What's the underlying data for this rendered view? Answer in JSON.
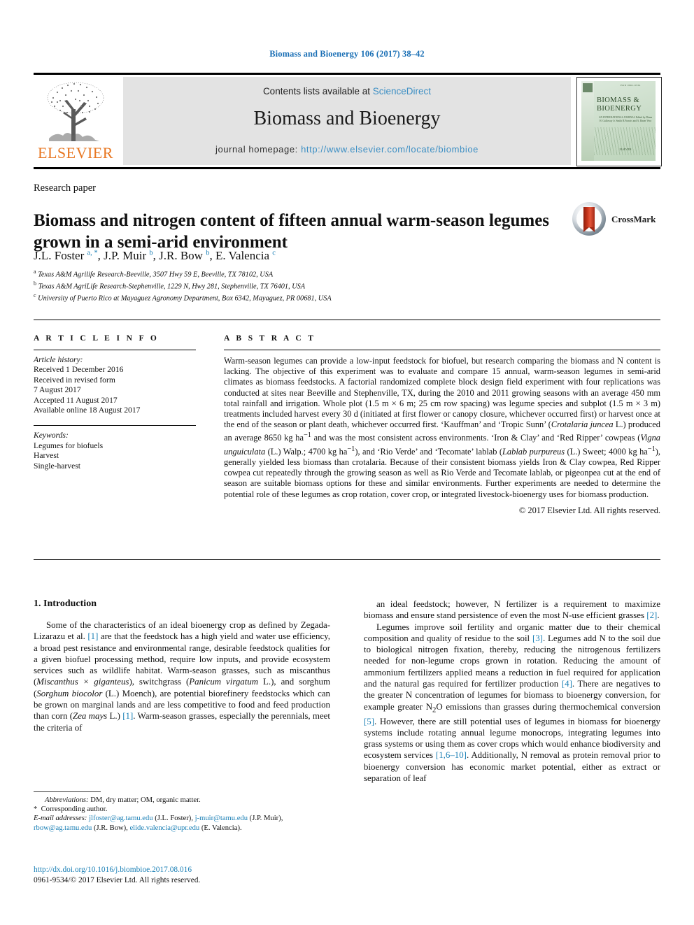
{
  "running_head": "Biomass and Bioenergy 106 (2017) 38–42",
  "journal_header": {
    "publisher_name": "ELSEVIER",
    "contents_prefix": "Contents lists available at ",
    "contents_link": "ScienceDirect",
    "journal_title": "Biomass and Bioenergy",
    "homepage_label": "journal homepage: ",
    "homepage_url": "http://www.elsevier.com/locate/biombioe",
    "cover": {
      "issn_top": "ISSN 0961-9534",
      "title_line1": "BIOMASS &",
      "title_line2": "BIOENERGY",
      "subtitle": "AN INTERNATIONAL JOURNAL\nEdited by Diana H. Galloway Jr. Smith\nR.Francis and A. Bauer Vera",
      "bottom": "ELSEVIER"
    }
  },
  "article": {
    "type": "Research paper",
    "title": "Biomass and nitrogen content of fifteen annual warm-season legumes grown in a semi-arid environment",
    "crossmark_label": "CrossMark",
    "authors_html": "J.L. Foster <sup>a, *</sup>, J.P. Muir <sup>b</sup>, J.R. Bow <sup>b</sup>, E. Valencia <sup>c</sup>",
    "affiliations": [
      "Texas A&M Agrilife Research-Beeville, 3507 Hwy 59 E, Beeville, TX 78102, USA",
      "Texas A&M AgriLife Research-Stephenville, 1229 N, Hwy 281, Stephenville, TX 76401, USA",
      "University of Puerto Rico at Mayaguez Agronomy Department, Box 6342, Mayaguez, PR 00681, USA"
    ],
    "affiliation_marks": [
      "a",
      "b",
      "c"
    ]
  },
  "article_info": {
    "heading": "A R T I C L E  I N F O",
    "history_label": "Article history:",
    "history": [
      "Received 1 December 2016",
      "Received in revised form",
      "7 August 2017",
      "Accepted 11 August 2017",
      "Available online 18 August 2017"
    ],
    "keywords_label": "Keywords:",
    "keywords": [
      "Legumes for biofuels",
      "Harvest",
      "Single-harvest"
    ]
  },
  "abstract": {
    "heading": "A B S T R A C T",
    "body_html": "Warm-season legumes can provide a low-input feedstock for biofuel, but research comparing the biomass and N content is lacking. The objective of this experiment was to evaluate and compare 15 annual, warm-season legumes in semi-arid climates as biomass feedstocks. A factorial randomized complete block design field experiment with four replications was conducted at sites near Beeville and Stephenville, TX, during the 2010 and 2011 growing seasons with an average 450 mm total rainfall and irrigation. Whole plot (1.5 m &#215; 6 m; 25 cm row spacing) was legume species and subplot (1.5 m &#215; 3 m) treatments included harvest every 30 d (initiated at first flower or canopy closure, whichever occurred first) or harvest once at the end of the season or plant death, whichever occurred first. &#8216;Kauffman&#8217; and &#8216;Tropic Sunn&#8217; (<span class=\"it\">Crotalaria juncea</span> L.) produced an average 8650 kg ha<sup>&#8722;1</sup> and was the most consistent across environments. &#8216;Iron &amp; Clay&#8217; and &#8216;Red Ripper&#8217; cowpeas (<span class=\"it\">Vigna unguiculata</span> (L.) Walp.; 4700 kg ha<sup>&#8722;1</sup>), and &#8216;Rio Verde&#8217; and &#8216;Tecomate&#8217; lablab (<span class=\"it\">Lablab purpureus</span> (L.) Sweet; 4000 kg ha<sup>&#8722;1</sup>), generally yielded less biomass than crotalaria. Because of their consistent biomass yields Iron &amp; Clay cowpea, Red Ripper cowpea cut repeatedly through the growing season as well as Rio Verde and Tecomate lablab, or pigeonpea cut at the end of season are suitable biomass options for these and similar environments. Further experiments are needed to determine the potential role of these legumes as crop rotation, cover crop, or integrated livestock-bioenergy uses for biomass production.",
    "copyright": "© 2017 Elsevier Ltd. All rights reserved."
  },
  "introduction": {
    "section_title": "1. Introduction",
    "left_paragraphs_html": [
      "Some of the characteristics of an ideal bioenergy crop as defined by Zegada-Lizarazu et al. <span class=\"ref\">[1]</span> are that the feedstock has a high yield and water use efficiency, a broad pest resistance and environmental range, desirable feedstock qualities for a given biofuel processing method, require low inputs, and provide ecosystem services such as wildlife habitat. Warm-season grasses, such as miscanthus (<span class=\"it\">Miscanthus &#215; giganteus</span>), switchgrass (<span class=\"it\">Panicum virgatum</span> L.), and sorghum (<span class=\"it\">Sorghum biocolor</span> (L.) Moench), are potential biorefinery feedstocks which can be grown on marginal lands and are less competitive to food and feed production than corn (<span class=\"it\">Zea mays</span> L.) <span class=\"ref\">[1]</span>. Warm-season grasses, especially the perennials, meet the criteria of"
    ],
    "right_paragraphs_html": [
      "an ideal feedstock; however, N fertilizer is a requirement to maximize biomass and ensure stand persistence of even the most N-use efficient grasses <span class=\"ref\">[2]</span>.",
      "Legumes improve soil fertility and organic matter due to their chemical composition and quality of residue to the soil <span class=\"ref\">[3]</span>. Legumes add N to the soil due to biological nitrogen fixation, thereby, reducing the nitrogenous fertilizers needed for non-legume crops grown in rotation. Reducing the amount of ammonium fertilizers applied means a reduction in fuel required for application and the natural gas required for fertilizer production <span class=\"ref\">[4]</span>. There are negatives to the greater N concentration of legumes for biomass to bioenergy conversion, for example greater N<sub>2</sub>O emissions than grasses during thermochemical conversion <span class=\"ref\">[5]</span>. However, there are still potential uses of legumes in biomass for bioenergy systems include rotating annual legume monocrops, integrating legumes into grass systems or using them as cover crops which would enhance biodiversity and ecosystem services <span class=\"ref\">[1,6&#8211;10]</span>. Additionally, N removal as protein removal prior to bioenergy conversion has economic market potential, either as extract or separation of leaf"
    ]
  },
  "footnotes": {
    "abbreviations_html": "<span class=\"it\">Abbreviations:</span> DM, dry matter; OM, organic matter.",
    "corresponding_author": "Corresponding author.",
    "emails_html": "<span class=\"it\">E-mail addresses:</span> <span class=\"lnk\">jlfoster@ag.tamu.edu</span> (J.L. Foster), <span class=\"lnk\">j-muir@tamu.edu</span> (J.P. Muir), <span class=\"lnk\">rbow@ag.tamu.edu</span> (J.R. Bow), <span class=\"lnk\">elide.valencia@upr.edu</span> (E. Valencia)."
  },
  "doi_block": {
    "doi_url": "http://dx.doi.org/10.1016/j.biombioe.2017.08.016",
    "issn_line": "0961-9534/© 2017 Elsevier Ltd. All rights reserved."
  },
  "colors": {
    "link_blue": "#1a7fb5",
    "sciencedirect_blue": "#3d8fc4",
    "elsevier_orange": "#E87722",
    "header_grey": "#e3e3e3"
  }
}
